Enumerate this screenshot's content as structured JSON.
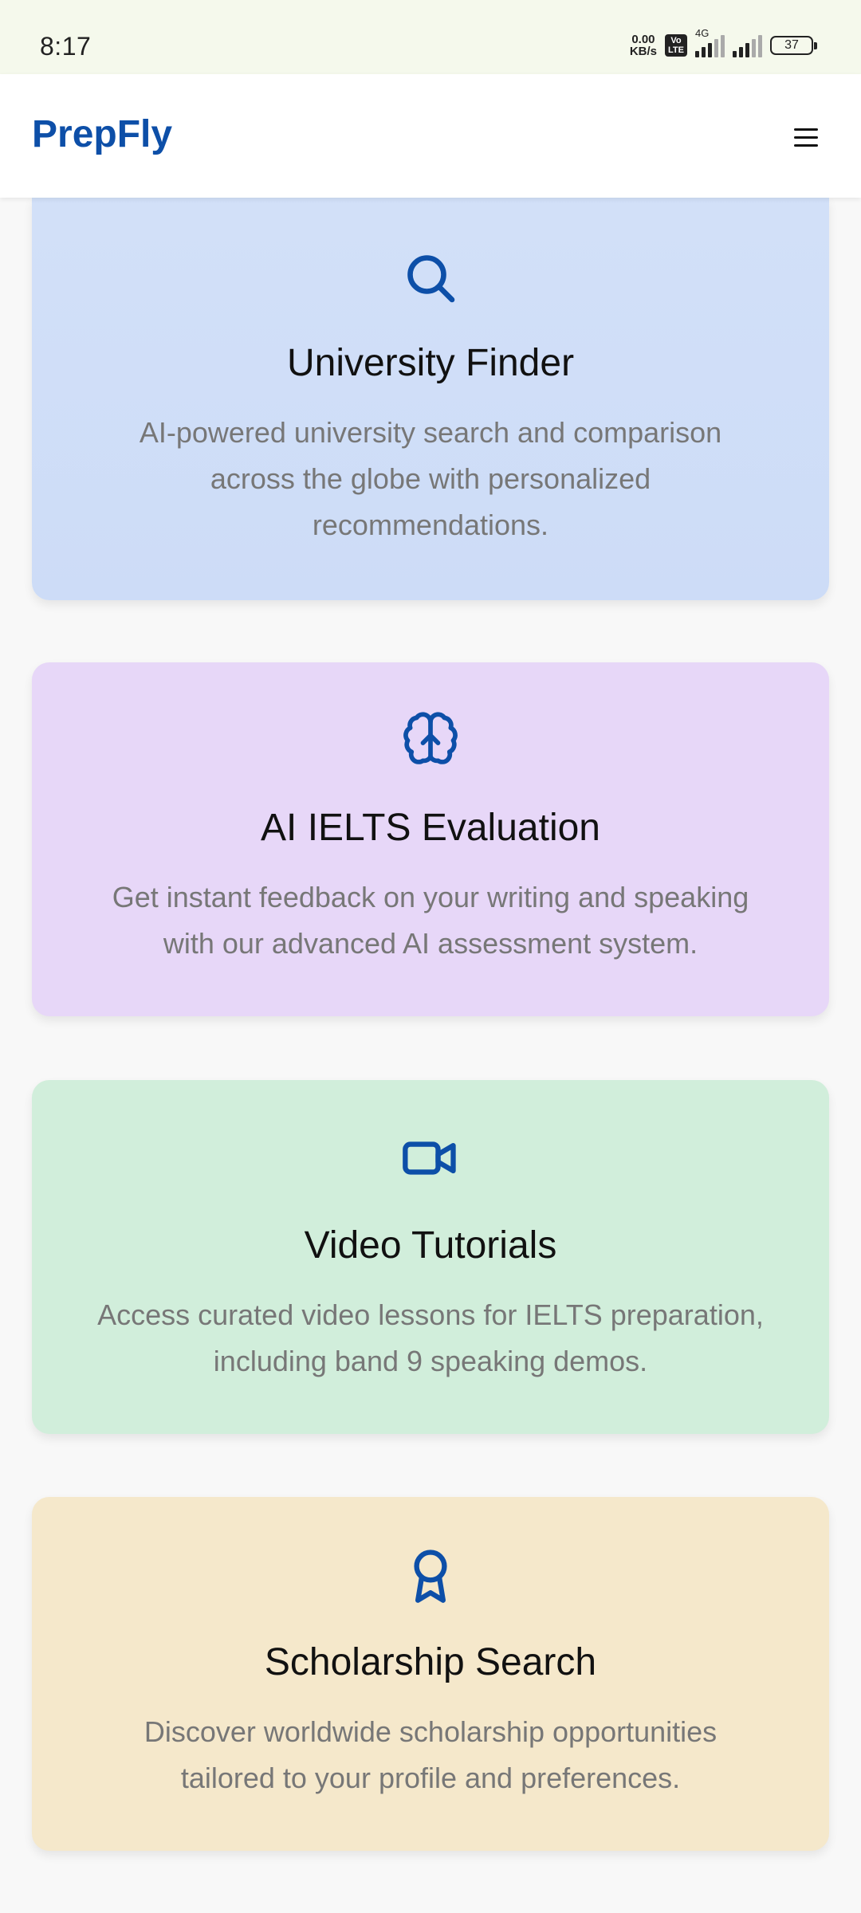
{
  "status_bar": {
    "time": "8:17",
    "net_speed_value": "0.00",
    "net_speed_unit": "KB/s",
    "volte_top": "Vo",
    "volte_bottom": "LTE",
    "network_type": "4G",
    "battery": "37"
  },
  "header": {
    "brand": "PrepFly",
    "menu_icon": "hamburger-menu-icon"
  },
  "features": [
    {
      "icon": "search-icon",
      "title": "University Finder",
      "description": "AI-powered university search and comparison across the globe with personalized recommendations.",
      "background": "#d2e0f8"
    },
    {
      "icon": "brain-icon",
      "title": "AI IELTS Evaluation",
      "description": "Get instant feedback on your writing and speaking with our advanced AI assessment system.",
      "background": "#e7d7f8"
    },
    {
      "icon": "video-camera-icon",
      "title": "Video Tutorials",
      "description": "Access curated video lessons for IELTS preparation, including band 9 speaking demos.",
      "background": "#d1eedb"
    },
    {
      "icon": "award-ribbon-icon",
      "title": "Scholarship Search",
      "description": "Discover worldwide scholarship opportunities tailored to your profile and preferences.",
      "background": "#f5e8cb"
    }
  ],
  "colors": {
    "brand": "#0d4fa8",
    "icon": "#0d4fa8",
    "title_text": "#111111",
    "description_text": "#777777"
  }
}
